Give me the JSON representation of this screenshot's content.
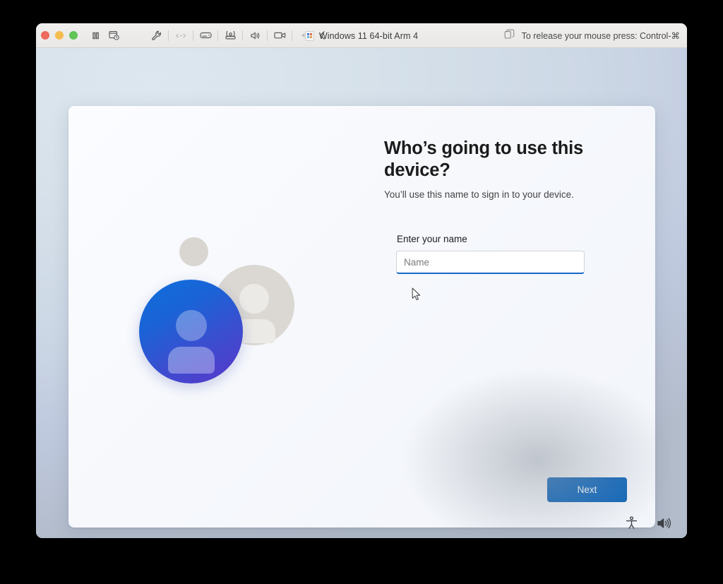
{
  "window": {
    "title": "Windows 11 64-bit Arm 4",
    "release_hint": "To release your mouse press: Control-⌘",
    "traffic_lights": [
      {
        "name": "close",
        "color": "#ec6a5e"
      },
      {
        "name": "minimize",
        "color": "#f4bd4f"
      },
      {
        "name": "maximize",
        "color": "#61c454"
      }
    ],
    "toolbar": [
      {
        "icon": "pause-icon",
        "label": "Pause",
        "enabled": true
      },
      {
        "icon": "snapshot-icon",
        "label": "Snapshots",
        "enabled": true
      },
      {
        "icon": "wrench-icon",
        "label": "Settings",
        "enabled": true
      },
      {
        "icon": "network-icon",
        "label": "Network",
        "enabled": true
      },
      {
        "icon": "harddisk-icon",
        "label": "Hard Disk",
        "enabled": true
      },
      {
        "icon": "camera-icon",
        "label": "Camera",
        "enabled": true
      },
      {
        "icon": "sound-icon",
        "label": "Sound",
        "enabled": true
      },
      {
        "icon": "video-icon",
        "label": "Video",
        "enabled": true
      },
      {
        "icon": "usb-icon",
        "label": "USB",
        "enabled": false
      },
      {
        "icon": "back-chevron-icon",
        "label": "Back",
        "enabled": true
      }
    ],
    "release_icon": "duplicate-icon",
    "app_icon": "windows-vm-icon"
  },
  "oobe": {
    "heading": "Who’s going to use this device?",
    "subtitle": "You’ll use this name to sign in to your device.",
    "field_label": "Enter your name",
    "name_value": "",
    "name_placeholder": "Name",
    "next_label": "Next",
    "accent_color": "#0964bb",
    "illustration": {
      "name": "user-avatars-illustration",
      "primary_color": "#1a63d6",
      "secondary_color": "#dbd8d3"
    }
  },
  "tray": [
    {
      "icon": "accessibility-icon",
      "label": "Accessibility"
    },
    {
      "icon": "volume-icon",
      "label": "Volume"
    }
  ]
}
